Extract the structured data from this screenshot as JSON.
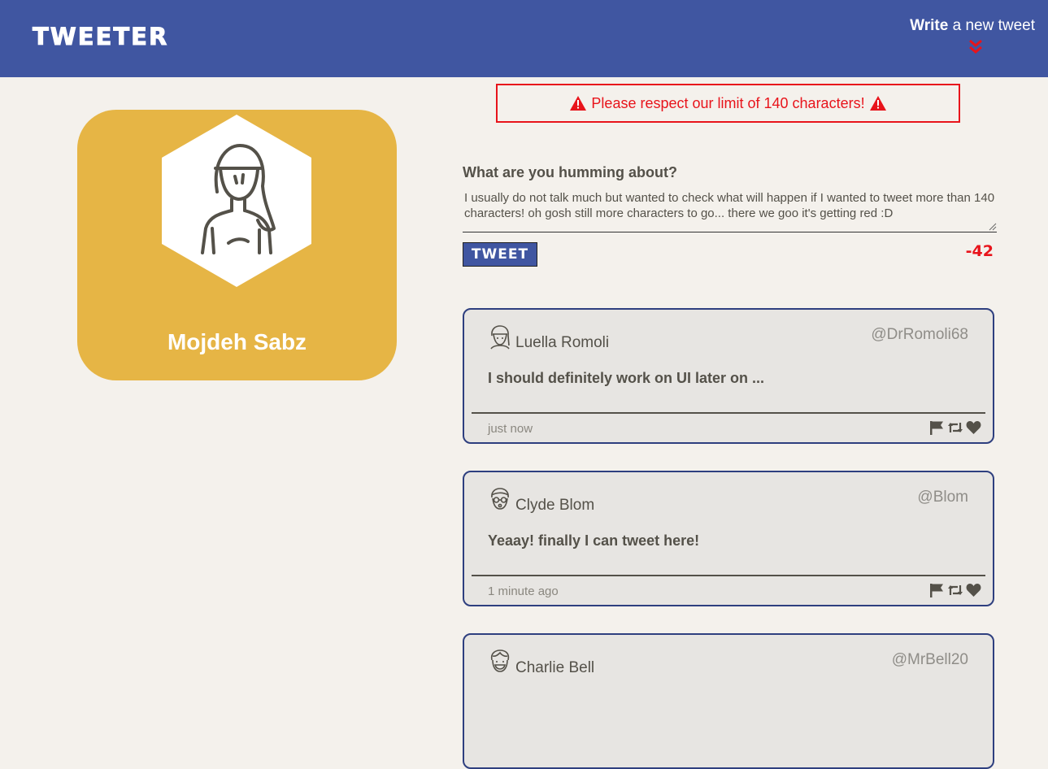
{
  "nav": {
    "brand": "TWEETER",
    "write_bold": "Write",
    "write_rest": " a new tweet",
    "accent": "#4056a1"
  },
  "error": {
    "message": "Please respect our limit of 140 characters!",
    "color": "#e8141b"
  },
  "profile": {
    "name": "Mojdeh Sabz",
    "card_color": "#e6b545"
  },
  "composer": {
    "prompt": "What are you humming about?",
    "value": "I usually do not talk much but wanted to check what will happen if I wanted to tweet more than 140 characters! oh gosh still more characters to go... there we goo it's getting red :D",
    "button_label": "TWEET",
    "counter": "-42"
  },
  "tweets": [
    {
      "name": "Luella Romoli",
      "handle": "@DrRomoli68",
      "content": "I should definitely work on UI later on ...",
      "time": "just now",
      "avatar_icon": "woman-avatar-icon"
    },
    {
      "name": "Clyde Blom",
      "handle": "@Blom",
      "content": "Yeaay! finally I can tweet here!",
      "time": "1 minute ago",
      "avatar_icon": "glasses-man-avatar-icon"
    },
    {
      "name": "Charlie Bell",
      "handle": "@MrBell20",
      "content": "",
      "time": "",
      "avatar_icon": "smiling-man-avatar-icon"
    }
  ]
}
